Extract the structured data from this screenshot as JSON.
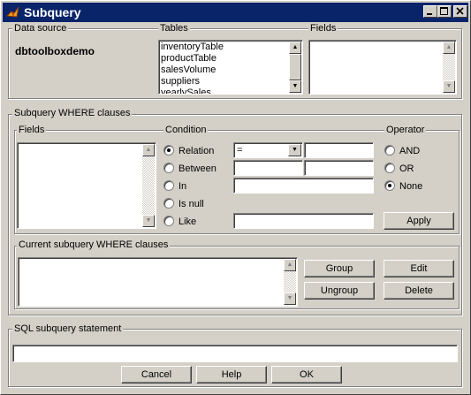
{
  "window": {
    "title": "Subquery",
    "title_buttons": [
      "_",
      "□",
      "X"
    ]
  },
  "data_source": {
    "label": "Data source",
    "value": "dbtoolboxdemo"
  },
  "tables": {
    "label": "Tables",
    "items": [
      "inventoryTable",
      "productTable",
      "salesVolume",
      "suppliers",
      "yearlySales"
    ]
  },
  "fields_top": {
    "label": "Fields"
  },
  "where": {
    "label": "Subquery WHERE clauses",
    "fields_label": "Fields",
    "condition": {
      "label": "Condition",
      "options": [
        "Relation",
        "Between",
        "In",
        "Is null",
        "Like"
      ],
      "selected": "Relation",
      "relation_operator": "="
    },
    "operator": {
      "label": "Operator",
      "options": [
        "AND",
        "OR",
        "None"
      ],
      "selected": "None"
    },
    "apply_label": "Apply"
  },
  "current": {
    "label": "Current subquery WHERE clauses",
    "buttons": {
      "group": "Group",
      "edit": "Edit",
      "ungroup": "Ungroup",
      "delete": "Delete"
    }
  },
  "sql": {
    "label": "SQL subquery statement",
    "value": ""
  },
  "footer": {
    "cancel": "Cancel",
    "help": "Help",
    "ok": "OK"
  },
  "colors": {
    "titlebar": "#0a246a",
    "face": "#d4d0c8",
    "icon": "#e8a317"
  }
}
